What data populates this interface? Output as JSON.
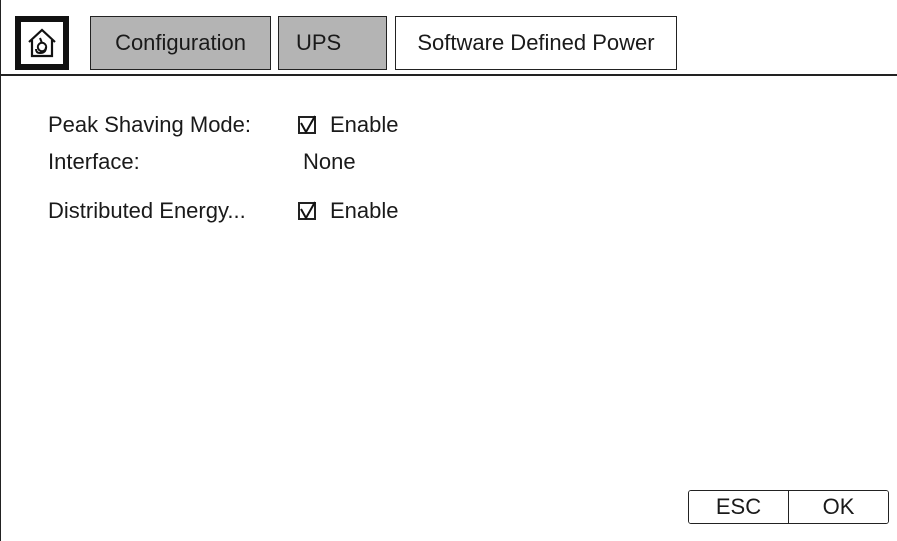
{
  "nav": {
    "home_icon": "home-icon",
    "breadcrumbs": [
      {
        "label": "Configuration",
        "state": "inactive"
      },
      {
        "label": "UPS",
        "state": "inactive"
      },
      {
        "label": "Software Defined Power",
        "state": "active"
      }
    ]
  },
  "settings": {
    "peak_shaving": {
      "label": "Peak Shaving Mode:",
      "checked": true,
      "value": "Enable"
    },
    "interface": {
      "label": "Interface:",
      "value": "None"
    },
    "distributed_energy": {
      "label": "Distributed Energy...",
      "checked": true,
      "value": "Enable"
    }
  },
  "footer": {
    "esc_label": "ESC",
    "ok_label": "OK"
  },
  "colors": {
    "inactive_tab": "#b4b4b4",
    "active_tab": "#ffffff",
    "home_bg": "#111111"
  }
}
